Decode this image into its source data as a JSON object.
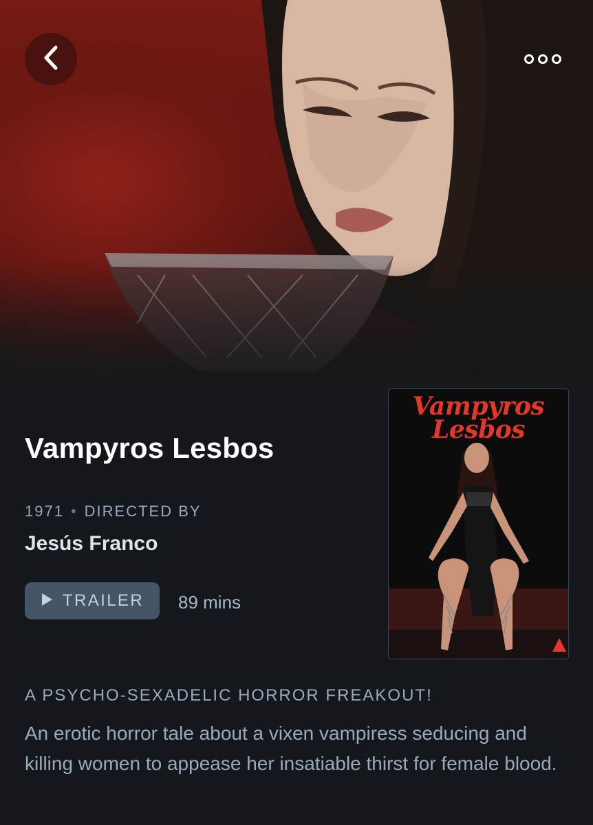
{
  "film": {
    "title": "Vampyros Lesbos",
    "year": "1971",
    "separator": "•",
    "directed_by_label": "DIRECTED BY",
    "director": "Jesús Franco",
    "trailer_label": "TRAILER",
    "runtime": "89 mins",
    "tagline": "A PSYCHO-SEXADELIC HORROR FREAKOUT!",
    "synopsis": "An erotic horror tale about a vixen vampiress seducing and killing women to appease her insatiable thirst for female blood."
  },
  "poster": {
    "logo_line1": "Vampyros",
    "logo_line2": "Lesbos"
  },
  "nav": {
    "back_icon": "chevron-left-icon",
    "more_icon": "more-horizontal-icon"
  },
  "colors": {
    "background": "#14181c",
    "accent_red": "#e0382a",
    "meta_text": "#99aabb",
    "button_bg": "#445566"
  }
}
